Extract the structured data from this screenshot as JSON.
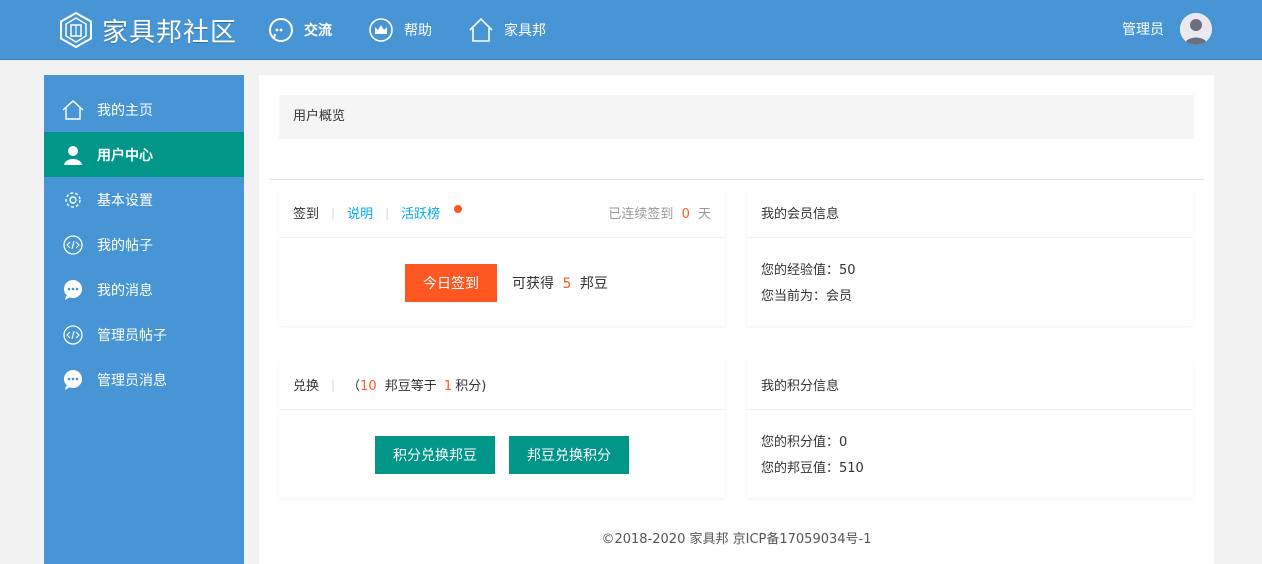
{
  "header": {
    "logo_text": "家具邦社区",
    "nav": [
      {
        "label": "交流",
        "icon": "chat-bubble-icon"
      },
      {
        "label": "帮助",
        "icon": "crown-icon"
      },
      {
        "label": "家具邦",
        "icon": "home-icon"
      }
    ],
    "user_name": "管理员"
  },
  "sidebar": {
    "items": [
      {
        "label": "我的主页",
        "icon": "home-icon"
      },
      {
        "label": "用户中心",
        "icon": "user-icon"
      },
      {
        "label": "基本设置",
        "icon": "gear-icon"
      },
      {
        "label": "我的帖子",
        "icon": "code-icon"
      },
      {
        "label": "我的消息",
        "icon": "chat-icon"
      },
      {
        "label": "管理员帖子",
        "icon": "code-icon"
      },
      {
        "label": "管理员消息",
        "icon": "chat-icon"
      }
    ]
  },
  "main": {
    "title": "用户概览",
    "signin": {
      "title": "签到",
      "link_explain": "说明",
      "link_rank": "活跃榜",
      "streak_prefix": "已连续签到",
      "streak_days": "0",
      "streak_suffix": "天",
      "button_label": "今日签到",
      "reward_prefix": "可获得",
      "reward_amount": "5",
      "reward_suffix": "邦豆"
    },
    "member": {
      "title": "我的会员信息",
      "exp_line": "您的经验值：50",
      "level_line": "您当前为：会员"
    },
    "exchange": {
      "title": "兑换",
      "rate_open": "（",
      "rate_beans": "10",
      "rate_mid": "邦豆等于",
      "rate_points": "1",
      "rate_close": "积分)",
      "btn_points_to_beans": "积分兑换邦豆",
      "btn_beans_to_points": "邦豆兑换积分"
    },
    "points": {
      "title": "我的积分信息",
      "points_line": "您的积分值：0",
      "beans_line": "您的邦豆值：510"
    },
    "footer": "©2018-2020 家具邦 京ICP备17059034号-1"
  },
  "colors": {
    "header_bg": "#4795d4",
    "active_teal": "#009688",
    "accent_orange": "#ff5722",
    "link_blue": "#01aaed"
  }
}
